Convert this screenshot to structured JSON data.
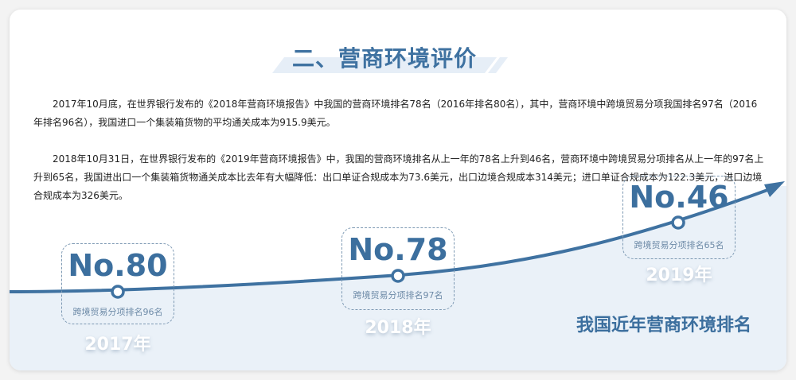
{
  "title": "二、营商环境评价",
  "paragraphs": [
    "2017年10月底，在世界银行发布的《2018年营商环境报告》中我国的营商环境排名78名（2016年排名80名），其中，营商环境中跨境贸易分项我国排名97名（2016年排名96名），我国进口一个集装箱货物的平均通关成本为915.9美元。",
    "2018年10月31日，在世界银行发布的《2019年营商环境报告》中，我国的营商环境排名从上一年的78名上升到46名，营商环境中跨境贸易分项排名从上一年的97名上升到65名，我国进出口一个集装箱货物通关成本比去年有大幅降低：出口单证合规成本为73.6美元，出口边境合规成本314美元；进口单证合规成本为122.3美元，进口边境合规成本为326美元。"
  ],
  "milestones": [
    {
      "rank": "No.80",
      "sub": "跨境贸易分项排名96名",
      "year": "2017年"
    },
    {
      "rank": "No.78",
      "sub": "跨境贸易分项排名97名",
      "year": "2018年"
    },
    {
      "rank": "No.46",
      "sub": "跨境贸易分项排名65名",
      "year": "2019年"
    }
  ],
  "caption": "我国近年营商环境排名",
  "colors": {
    "accent": "#3f72a1",
    "fill": "#eaf1f8"
  }
}
